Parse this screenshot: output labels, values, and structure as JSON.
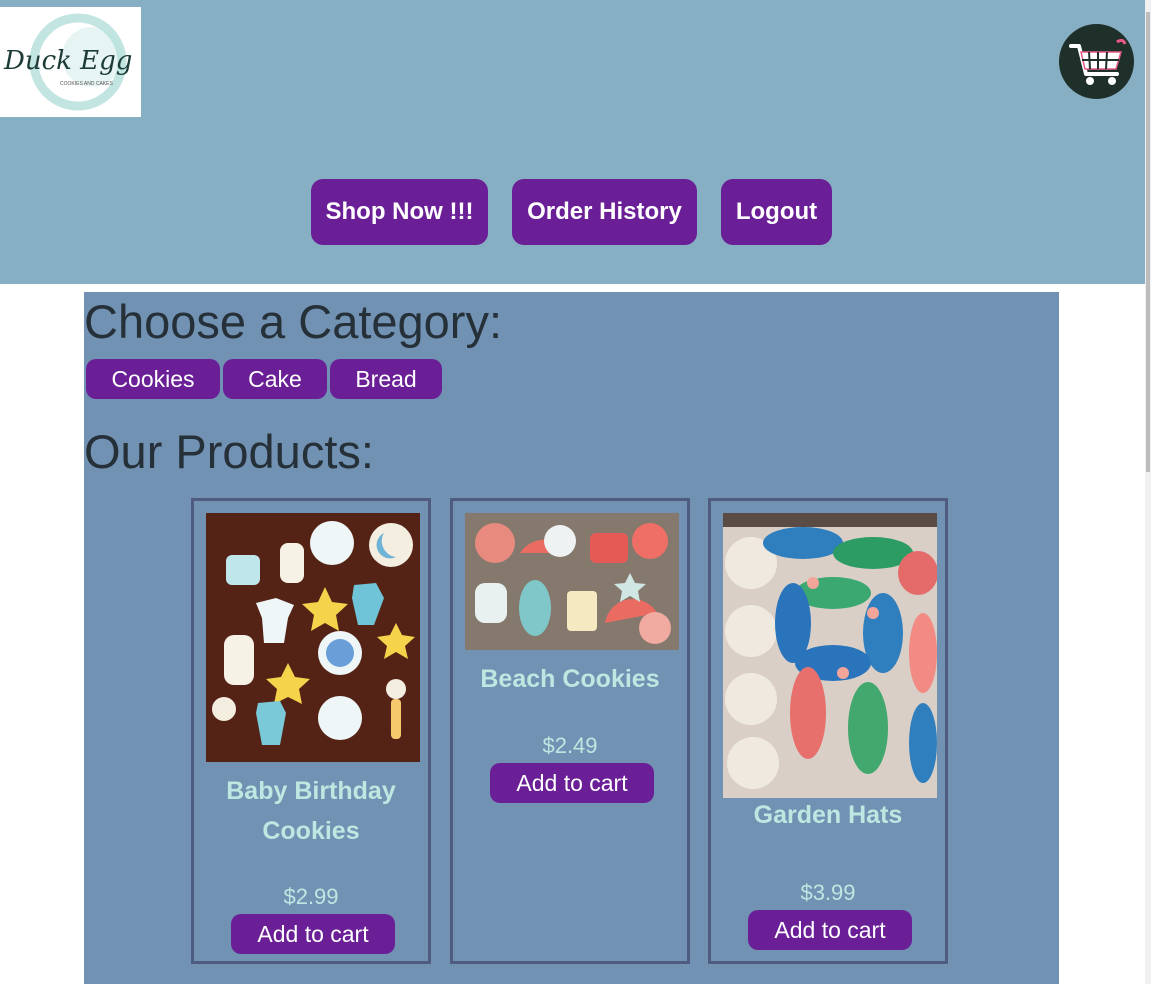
{
  "header": {
    "logo_text": "Duck Egg",
    "logo_subtext": "COOKIES AND CAKES",
    "cart_icon": "shopping-cart-icon",
    "nav": [
      {
        "label": "Shop Now !!!"
      },
      {
        "label": "Order History"
      },
      {
        "label": "Logout"
      }
    ]
  },
  "main": {
    "category_heading": "Choose a Category:",
    "categories": [
      {
        "label": "Cookies"
      },
      {
        "label": "Cake"
      },
      {
        "label": "Bread"
      }
    ],
    "products_heading": "Our Products:",
    "products": [
      {
        "name_line1": "Baby Birthday",
        "name_line2": "Cookies",
        "price": "$2.99",
        "button": "Add to cart"
      },
      {
        "name_line1": "Beach Cookies",
        "price": "$2.49",
        "button": "Add to cart"
      },
      {
        "name_line1": "Garden Hats",
        "price": "$3.99",
        "button": "Add to cart"
      }
    ]
  },
  "colors": {
    "header_bg": "#87afc3",
    "main_bg": "#7292b3",
    "button_purple": "#6a1f97",
    "product_text": "#bfe7e2"
  }
}
